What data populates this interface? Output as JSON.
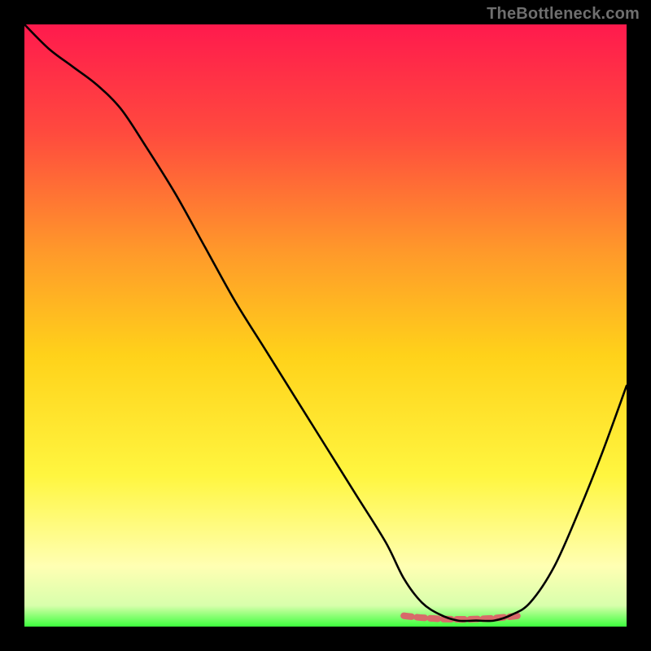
{
  "watermark": "TheBottleneck.com",
  "colors": {
    "page_bg": "#000000",
    "watermark": "#6f6f6f",
    "curve": "#000000",
    "flat_marker": "#d86a6a",
    "grad_top": "#ff1a4d",
    "grad_mid_upper": "#ff7a33",
    "grad_mid": "#ffd21a",
    "grad_lower": "#fff640",
    "grad_near_bottom": "#ffffb3",
    "grad_bottom": "#3dff3d"
  },
  "chart_data": {
    "type": "line",
    "title": "",
    "xlabel": "",
    "ylabel": "",
    "xlim": [
      0,
      100
    ],
    "ylim": [
      0,
      100
    ],
    "series": [
      {
        "name": "bottleneck-curve",
        "x": [
          0,
          4,
          8,
          12,
          16,
          20,
          25,
          30,
          35,
          40,
          45,
          50,
          55,
          60,
          63,
          66,
          69,
          72,
          75,
          78,
          81,
          84,
          88,
          92,
          96,
          100
        ],
        "y": [
          100,
          96,
          93,
          90,
          86,
          80,
          72,
          63,
          54,
          46,
          38,
          30,
          22,
          14,
          8,
          4,
          2,
          1,
          1,
          1,
          2,
          4,
          10,
          19,
          29,
          40
        ]
      }
    ],
    "flat_region": {
      "x_start": 63,
      "x_end": 82,
      "y": 1.2
    },
    "gradient_stops": [
      {
        "offset": 0.0,
        "color": "#ff1a4d"
      },
      {
        "offset": 0.18,
        "color": "#ff4a3e"
      },
      {
        "offset": 0.38,
        "color": "#ff9a2a"
      },
      {
        "offset": 0.55,
        "color": "#ffd21a"
      },
      {
        "offset": 0.75,
        "color": "#fff640"
      },
      {
        "offset": 0.9,
        "color": "#ffffb3"
      },
      {
        "offset": 0.965,
        "color": "#d8ffac"
      },
      {
        "offset": 1.0,
        "color": "#3dff3d"
      }
    ]
  }
}
